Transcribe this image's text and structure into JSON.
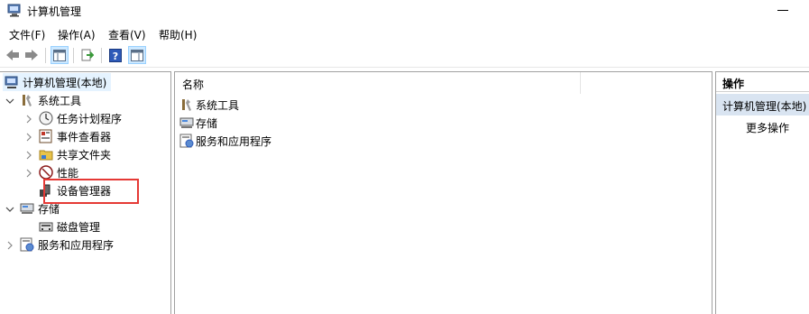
{
  "window": {
    "title": "计算机管理"
  },
  "menu": {
    "file": "文件(F)",
    "action": "操作(A)",
    "view": "查看(V)",
    "help": "帮助(H)"
  },
  "tree": {
    "root": "计算机管理(本地)",
    "system_tools": "系统工具",
    "task_scheduler": "任务计划程序",
    "event_viewer": "事件查看器",
    "shared_folders": "共享文件夹",
    "performance": "性能",
    "device_manager": "设备管理器",
    "storage": "存储",
    "disk_management": "磁盘管理",
    "services_apps": "服务和应用程序"
  },
  "list": {
    "column_name": "名称",
    "items": [
      "系统工具",
      "存储",
      "服务和应用程序"
    ]
  },
  "actions": {
    "header": "操作",
    "group": "计算机管理(本地)",
    "more": "更多操作"
  },
  "colors": {
    "selection": "#e5f3ff",
    "action_group": "#d9e4f1",
    "highlight": "#e53935"
  }
}
